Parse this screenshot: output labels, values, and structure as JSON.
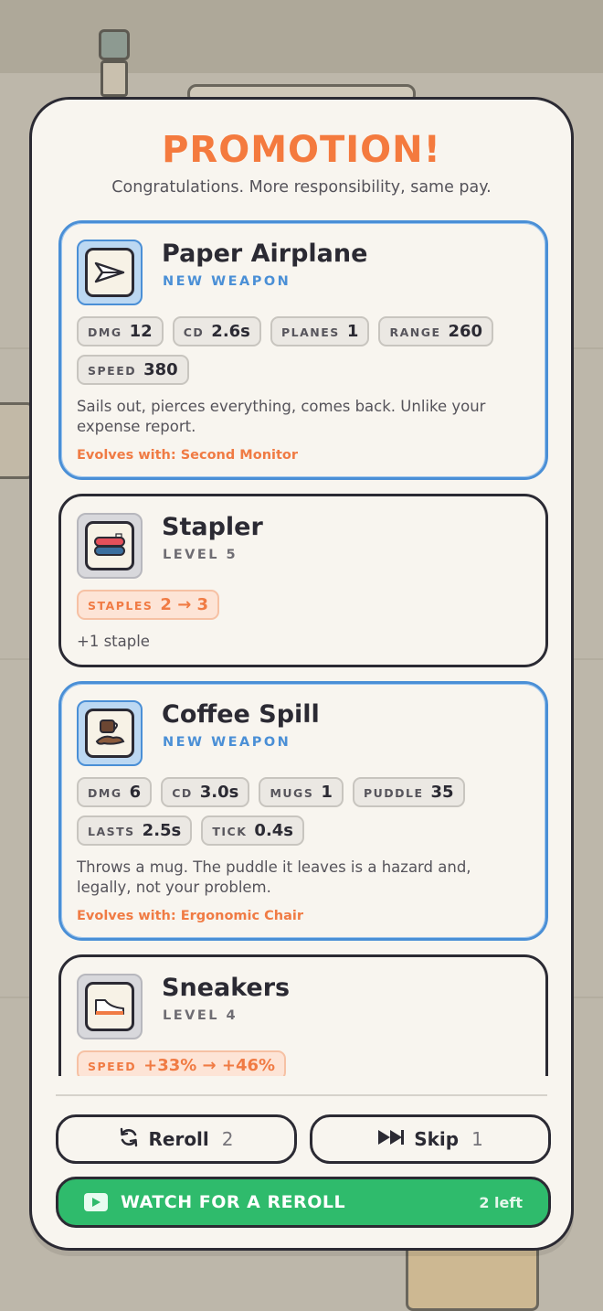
{
  "modal": {
    "title": "PROMOTION!",
    "subtitle": "Congratulations. More responsibility, same pay."
  },
  "cards": [
    {
      "name": "Paper Airplane",
      "tag": "NEW WEAPON",
      "icon": "paper-airplane-icon",
      "stats": [
        {
          "key": "DMG",
          "value": "12"
        },
        {
          "key": "CD",
          "value": "2.6s"
        },
        {
          "key": "PLANES",
          "value": "1"
        },
        {
          "key": "RANGE",
          "value": "260"
        },
        {
          "key": "SPEED",
          "value": "380"
        }
      ],
      "description": "Sails out, pierces everything, comes back. Unlike your expense report.",
      "evolves": "Evolves with: Second Monitor"
    },
    {
      "name": "Stapler",
      "tag": "LEVEL 5",
      "icon": "stapler-icon",
      "upgrade": {
        "key": "STAPLES",
        "value": "2 → 3"
      },
      "description": "+1 staple"
    },
    {
      "name": "Coffee Spill",
      "tag": "NEW WEAPON",
      "icon": "coffee-mug-icon",
      "stats": [
        {
          "key": "DMG",
          "value": "6"
        },
        {
          "key": "CD",
          "value": "3.0s"
        },
        {
          "key": "MUGS",
          "value": "1"
        },
        {
          "key": "PUDDLE",
          "value": "35"
        },
        {
          "key": "LASTS",
          "value": "2.5s"
        },
        {
          "key": "TICK",
          "value": "0.4s"
        }
      ],
      "description": "Throws a mug. The puddle it leaves is a hazard and, legally, not your problem.",
      "evolves": "Evolves with: Ergonomic Chair"
    },
    {
      "name": "Sneakers",
      "tag": "LEVEL 4",
      "icon": "sneaker-icon",
      "upgrade": {
        "key": "SPEED",
        "value": "+33% → +46%"
      }
    }
  ],
  "actions": {
    "reroll_label": "Reroll",
    "reroll_count": "2",
    "skip_label": "Skip",
    "skip_count": "1",
    "watch_label": "WATCH FOR A REROLL",
    "watch_left": "2 left"
  },
  "colors": {
    "accent": "#f47a3e",
    "new_weapon": "#4a8fd6",
    "watch_button": "#2fbb6c",
    "outline": "#2b2a33"
  }
}
